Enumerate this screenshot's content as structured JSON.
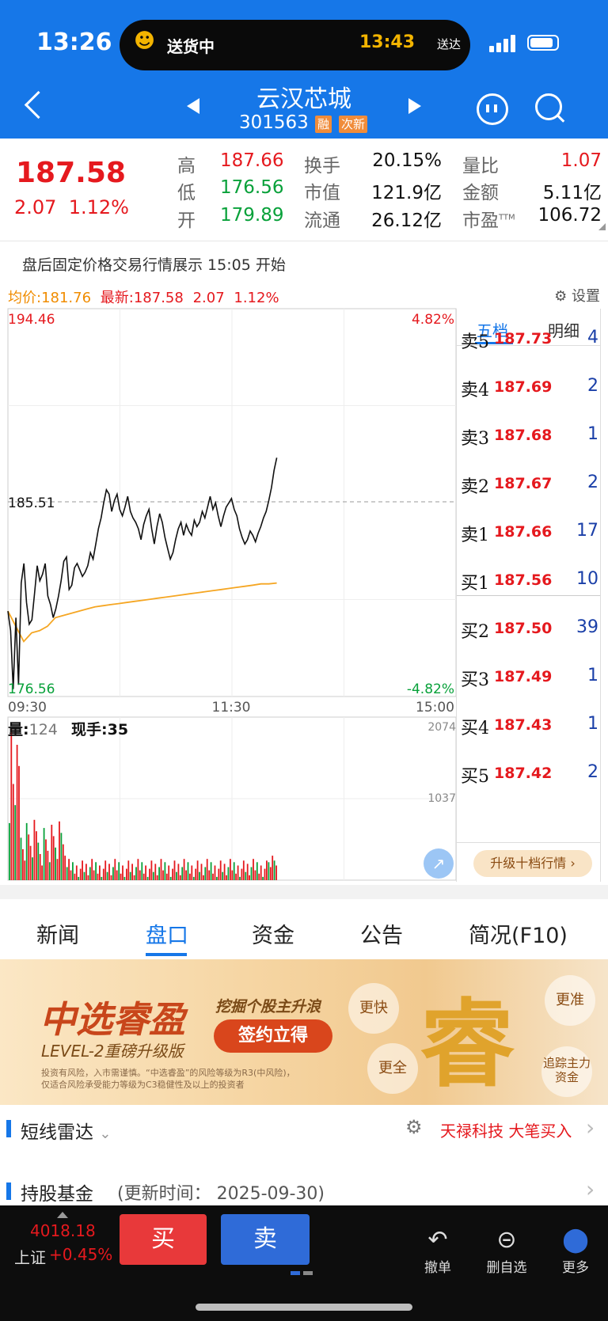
{
  "status": {
    "time": "13:26",
    "island_label": "送货中",
    "island_time": "13:43",
    "island_tag": "送达"
  },
  "header": {
    "name": "云汉芯城",
    "code": "301563",
    "tags": [
      "融",
      "次新"
    ]
  },
  "quote": {
    "price": "187.58",
    "change": "2.07",
    "change_pct": "1.12%",
    "fields": [
      {
        "label": "高",
        "value": "187.66",
        "color": "red"
      },
      {
        "label": "换手",
        "value": "20.15%",
        "color": "dark"
      },
      {
        "label": "量比",
        "value": "1.07",
        "color": "red"
      },
      {
        "label": "低",
        "value": "176.56",
        "color": "green"
      },
      {
        "label": "市值",
        "value": "121.9亿",
        "color": "dark"
      },
      {
        "label": "金额",
        "value": "5.11亿",
        "color": "dark"
      },
      {
        "label": "开",
        "value": "179.89",
        "color": "green"
      },
      {
        "label": "流通",
        "value": "26.12亿",
        "color": "dark"
      },
      {
        "label": "市盈",
        "value": "106.72",
        "color": "dark",
        "sup": "TTM"
      }
    ]
  },
  "notice": "盘后固定价格交易行情展示 15:05 开始",
  "chart_header": {
    "avg_label": "均价:181.76",
    "latest_label": "最新:187.58",
    "change": "2.07",
    "pct": "1.12%",
    "settings": "设置"
  },
  "chart_data": {
    "type": "line",
    "title": "",
    "ylim": [
      176.56,
      194.46
    ],
    "y_ticks": {
      "top": "194.46",
      "mid": "185.51",
      "bottom": "176.56"
    },
    "pct_ticks": {
      "top": "4.82%",
      "bottom": "-4.82%"
    },
    "x_ticks": [
      "09:30",
      "11:30",
      "15:00"
    ],
    "series": [
      {
        "color": "#111111",
        "values": [
          180.5,
          179.6,
          176.9,
          180.2,
          177.1,
          181.8,
          182.7,
          180.9,
          179.9,
          180.1,
          181.3,
          182.6,
          181.9,
          182.2,
          182.7,
          181.2,
          180.8,
          180.2,
          180.6,
          181.2,
          181.9,
          182.8,
          183.0,
          181.5,
          181.7,
          182.5,
          182.7,
          182.4,
          182.1,
          182.3,
          182.6,
          183.2,
          182.9,
          183.6,
          184.3,
          184.8,
          185.5,
          186.1,
          185.9,
          185.1,
          185.6,
          185.9,
          185.2,
          184.9,
          185.3,
          185.8,
          185.1,
          184.8,
          184.6,
          184.3,
          183.8,
          184.5,
          184.9,
          185.2,
          184.3,
          183.6,
          184.4,
          185.0,
          184.6,
          183.9,
          183.4,
          182.9,
          183.2,
          183.8,
          184.3,
          184.6,
          184.0,
          184.5,
          184.2,
          184.0,
          184.7,
          184.4,
          184.6,
          185.1,
          184.8,
          185.3,
          185.8,
          185.2,
          185.5,
          184.9,
          184.4,
          184.9,
          185.3,
          185.5,
          185.7,
          185.2,
          184.9,
          184.3,
          183.9,
          183.6,
          183.8,
          184.2,
          184.0,
          183.7,
          184.1,
          184.4,
          184.8,
          185.1,
          185.6,
          186.2,
          187.0,
          187.58
        ]
      },
      {
        "color": "#f5a623",
        "values": [
          180.5,
          179.8,
          179.1,
          179.5,
          179.6,
          179.8,
          180.2,
          180.3,
          180.4,
          180.5,
          180.6,
          180.7,
          180.75,
          180.8,
          180.85,
          180.9,
          180.95,
          181.0,
          181.05,
          181.1,
          181.15,
          181.2,
          181.25,
          181.3,
          181.35,
          181.4,
          181.45,
          181.5,
          181.55,
          181.6,
          181.65,
          181.7,
          181.76,
          181.76,
          181.8
        ]
      }
    ],
    "volume": {
      "label": "量",
      "value": "124",
      "current_hand_label": "现手",
      "current_hand": "35",
      "max_label": "2074",
      "mid_label": "1037",
      "max": 2074
    }
  },
  "orderbook": {
    "tabs": [
      "五档",
      "明细"
    ],
    "asks": [
      {
        "label": "卖5",
        "price": "187.73",
        "vol": "4"
      },
      {
        "label": "卖4",
        "price": "187.69",
        "vol": "2"
      },
      {
        "label": "卖3",
        "price": "187.68",
        "vol": "1"
      },
      {
        "label": "卖2",
        "price": "187.67",
        "vol": "2"
      },
      {
        "label": "卖1",
        "price": "187.66",
        "vol": "17"
      }
    ],
    "bids": [
      {
        "label": "买1",
        "price": "187.56",
        "vol": "10"
      },
      {
        "label": "买2",
        "price": "187.50",
        "vol": "39"
      },
      {
        "label": "买3",
        "price": "187.49",
        "vol": "1"
      },
      {
        "label": "买4",
        "price": "187.43",
        "vol": "1"
      },
      {
        "label": "买5",
        "price": "187.42",
        "vol": "2"
      }
    ],
    "upgrade": "升级十档行情"
  },
  "tabs": [
    "新闻",
    "盘口",
    "资金",
    "公告",
    "简况(F10)"
  ],
  "banner": {
    "title": "中选睿盈",
    "subtitle": "LEVEL-2重磅升级版",
    "slogan": "挖掘个股主升浪",
    "cta": "签约立得",
    "note1": "投资有风险，入市需谨慎。“中选睿盈”的风险等级为R3(中风险)，",
    "note2": "仅适合风险承受能力等级为C3稳健性及以上的投资者",
    "bubbles": [
      "更快",
      "更准",
      "更全",
      "追踪主力资金"
    ],
    "big": "睿"
  },
  "radar": {
    "title": "短线雷达",
    "alert": "天禄科技 大笔买入"
  },
  "fund": {
    "title": "持股基金",
    "update": "(更新时间：  2025-09-30)"
  },
  "bottom": {
    "index_value": "4018.18",
    "index_name": "上证",
    "index_pct": "+0.45%",
    "buy": "买",
    "sell": "卖",
    "actions": [
      {
        "label": "撤单",
        "icon": "undo-icon"
      },
      {
        "label": "删自选",
        "icon": "minus-circle-icon"
      },
      {
        "label": "更多",
        "icon": "more-icon"
      }
    ]
  }
}
